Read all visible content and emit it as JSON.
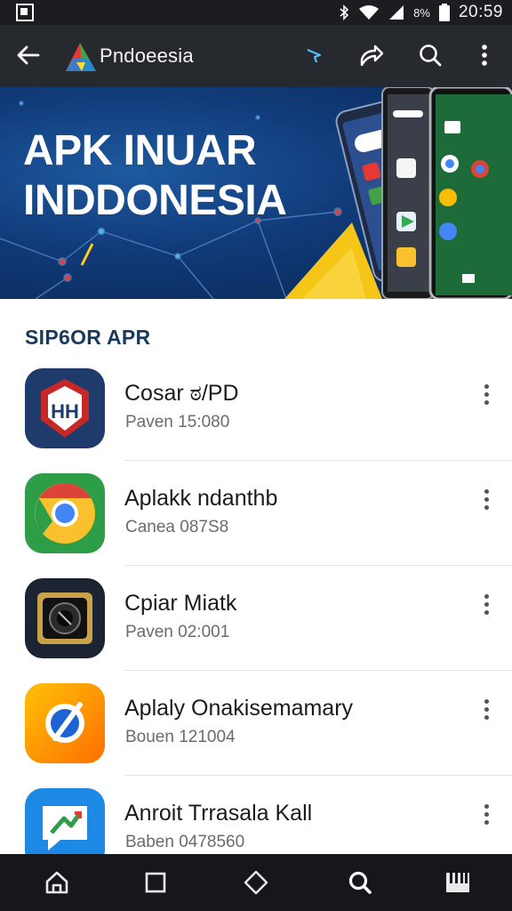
{
  "status_bar": {
    "battery_text": "8%",
    "time": "20:59",
    "icons": [
      "notification-icon",
      "bluetooth-icon",
      "wifi-icon",
      "signal-icon",
      "battery-icon"
    ]
  },
  "app_bar": {
    "title": "Pndoeesia",
    "icons": [
      "back-arrow-icon",
      "app-logo",
      "cast-icon",
      "share-icon",
      "search-icon",
      "overflow-menu-icon"
    ]
  },
  "banner": {
    "line1": "APK INUAR",
    "line2": "INDDONESIA"
  },
  "section": {
    "title": "SIP6OR APR"
  },
  "apps": [
    {
      "name": "Cosar ಠ/PD",
      "subtitle": "Paven 15:080",
      "icon": "shield-app-icon"
    },
    {
      "name": "Aplakk ndanthb",
      "subtitle": "Canea 087S8",
      "icon": "chrome-app-icon"
    },
    {
      "name": "Cpiar Miatk",
      "subtitle": "Paven 02:001",
      "icon": "camera-app-icon"
    },
    {
      "name": "Aplaly Onakisemamary",
      "subtitle": "Bouen 121004",
      "icon": "browser-app-icon"
    },
    {
      "name": "Anroit Trrasala Kall",
      "subtitle": "Baben 0478560",
      "icon": "chat-app-icon"
    }
  ],
  "bottom_nav": {
    "items": [
      "home-icon",
      "square-icon",
      "diamond-icon",
      "search-icon",
      "piano-icon"
    ]
  },
  "colors": {
    "status_bar": "#1b1d21",
    "app_bar": "#26292e",
    "banner": "#103a78",
    "section_title": "#1a3a5c",
    "nav_bar": "#16171a"
  }
}
